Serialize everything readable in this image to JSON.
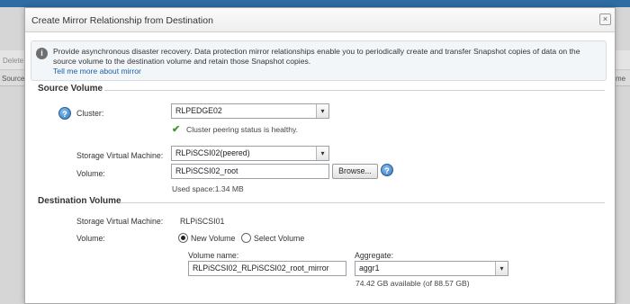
{
  "background": {
    "toolbar_left_text": "Delete",
    "header_left_text": "Source",
    "header_right_text": "me"
  },
  "dialog": {
    "title": "Create Mirror Relationship from Destination",
    "close_label": "×",
    "info": {
      "icon_glyph": "i",
      "text": "Provide asynchronous disaster recovery. Data protection mirror relationships enable you to periodically create and transfer Snapshot copies of data on the source volume to the destination volume and retain those Snapshot copies.",
      "link": "Tell me more about mirror"
    },
    "source": {
      "section_title": "Source Volume",
      "cluster_label": "Cluster:",
      "cluster_value": "RLPEDGE02",
      "peering_status": "Cluster peering status is healthy.",
      "svm_label": "Storage Virtual Machine:",
      "svm_value": "RLPiSCSI02(peered)",
      "volume_label": "Volume:",
      "volume_value": "RLPiSCSI02_root",
      "browse_label": "Browse...",
      "used_space": "Used space:1.34 MB"
    },
    "destination": {
      "section_title": "Destination Volume",
      "svm_label": "Storage Virtual Machine:",
      "svm_value": "RLPiSCSI01",
      "volume_label": "Volume:",
      "radio_new": "New Volume",
      "radio_select": "Select Volume",
      "volume_name_label": "Volume name:",
      "volume_name_value": "RLPiSCSI02_RLPiSCSI02_root_mirror",
      "aggregate_label": "Aggregate:",
      "aggregate_value": "aggr1",
      "aggregate_available": "74.42 GB available (of 88.57 GB)"
    }
  },
  "icons": {
    "dropdown_glyph": "▾",
    "help_glyph": "?",
    "check_glyph": "✔"
  },
  "colors": {
    "link": "#1a5ea8",
    "title_bar_blue": "#2e6da4",
    "check_green": "#3a9b2c"
  }
}
